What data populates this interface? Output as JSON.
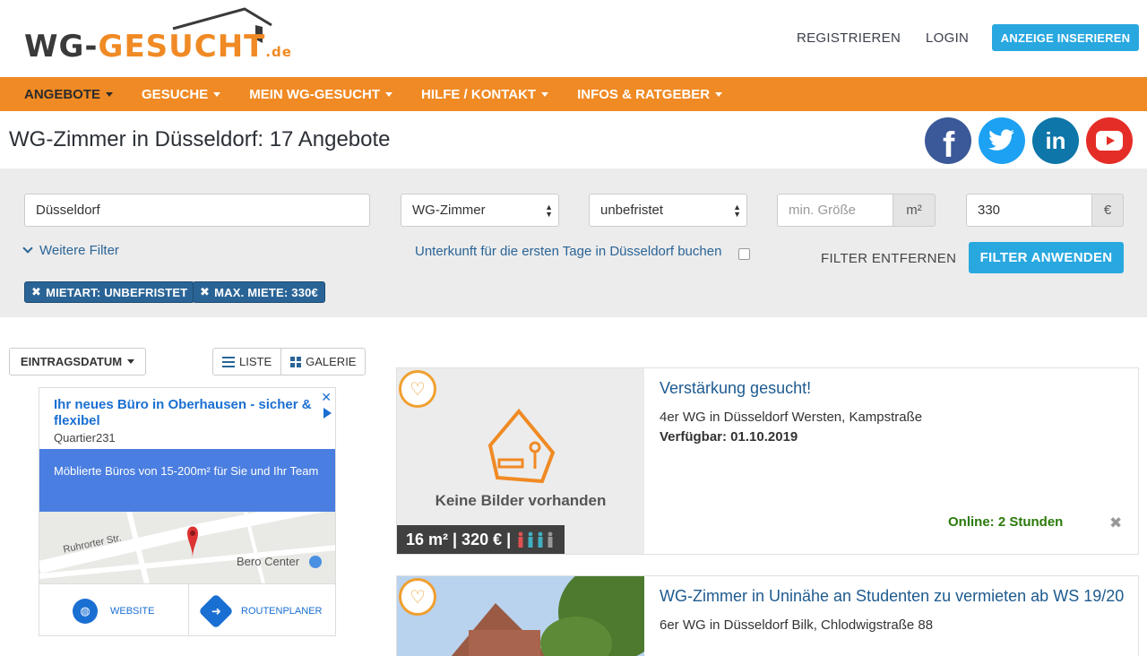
{
  "header": {
    "logo": {
      "part1": "WG-",
      "part2": "GESUCHT",
      "suffix": ".de"
    },
    "register_label": "REGISTRIEREN",
    "login_label": "LOGIN",
    "insert_ad_label": "ANZEIGE INSERIEREN",
    "insert_ad_color": "#29a8e0"
  },
  "nav": {
    "bar_color": "#f08a24",
    "items": [
      {
        "label": "ANGEBOTE",
        "active": true
      },
      {
        "label": "GESUCHE"
      },
      {
        "label": "MEIN WG-GESUCHT"
      },
      {
        "label": "HILFE / KONTAKT"
      },
      {
        "label": "INFOS & RATGEBER"
      }
    ]
  },
  "page": {
    "title": "WG-Zimmer in Düsseldorf: 17 Angebote"
  },
  "social": [
    {
      "name": "facebook-icon",
      "color": "#3b5998",
      "glyph": "f"
    },
    {
      "name": "twitter-icon",
      "color": "#1da1f2",
      "glyph": "t"
    },
    {
      "name": "linkedin-icon",
      "color": "#0e76a8",
      "glyph": "in"
    },
    {
      "name": "youtube-icon",
      "color": "#e52d27",
      "glyph": "▶"
    }
  ],
  "filter": {
    "city_value": "Düsseldorf",
    "category_value": "WG-Zimmer",
    "rent_type_value": "unbefristet",
    "min_size_placeholder": "min. Größe",
    "size_unit": "m²",
    "max_rent_value": "330",
    "currency_unit": "€",
    "more_filters_label": "Weitere Filter",
    "stay_link_label": "Unterkunft für die ersten Tage in Düsseldorf buchen",
    "remove_filters_label": "FILTER ENTFERNEN",
    "apply_filters_label": "FILTER ANWENDEN",
    "active_tags": [
      {
        "label": "MIETART: UNBEFRISTET"
      },
      {
        "label": "MAX. MIETE: 330€"
      }
    ]
  },
  "toolbar": {
    "sort_label": "EINTRAGSDATUM",
    "list_label": "LISTE",
    "gallery_label": "GALERIE"
  },
  "ad": {
    "title": "Ihr neues Büro in Oberhausen - sicher & flexibel",
    "advertiser": "Quartier231",
    "body": "Möblierte Büros von 15-200m² für Sie und Ihr Team",
    "map_street": "Ruhrorter Str.",
    "map_place": "Bero Center",
    "website_label": "WEBSITE",
    "route_label": "ROUTENPLANER"
  },
  "listings": [
    {
      "title": "Verstärkung gesucht!",
      "description": "4er WG in Düsseldorf Wersten, Kampstraße",
      "available": "Verfügbar: 01.10.2019",
      "no_image_text": "Keine Bilder vorhanden",
      "badge": "16 m² | 320 € |",
      "online": "Online: 2 Stunden"
    },
    {
      "title": "WG-Zimmer in Uninähe an Studenten zu vermieten ab WS 19/20",
      "description": "6er WG in Düsseldorf Bilk, Chlodwigstraße 88"
    }
  ]
}
